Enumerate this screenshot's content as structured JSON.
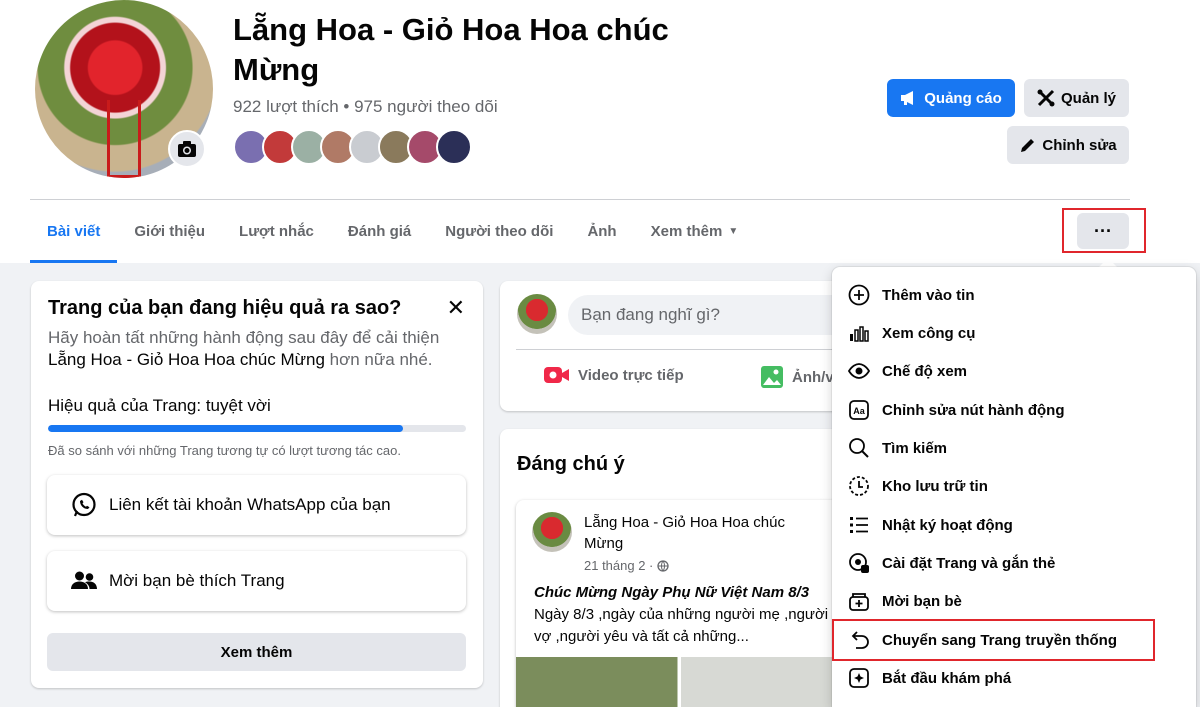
{
  "page": {
    "title": "Lẵng Hoa - Giỏ Hoa Hoa chúc Mừng",
    "stats": "922 lượt thích • 975 người theo dõi"
  },
  "header_buttons": {
    "ads": "Quảng cáo",
    "manage": "Quản lý",
    "edit": "Chỉnh sửa"
  },
  "tabs": [
    {
      "label": "Bài viết",
      "active": true
    },
    {
      "label": "Giới thiệu",
      "active": false
    },
    {
      "label": "Lượt nhắc",
      "active": false
    },
    {
      "label": "Đánh giá",
      "active": false
    },
    {
      "label": "Người theo dõi",
      "active": false
    },
    {
      "label": "Ảnh",
      "active": false
    },
    {
      "label": "Xem thêm",
      "active": false
    }
  ],
  "more_button": "···",
  "performance_card": {
    "title": "Trang của bạn đang hiệu quả ra sao?",
    "close": "✕",
    "description": "Hãy hoàn tất những hành động sau đây để cải thiện",
    "page_name": "Lẵng Hoa - Giỏ Hoa Hoa chúc Mừng",
    "description_end": " hơn nữa nhé.",
    "performance_label": "Hiệu quả của Trang: tuyệt vời",
    "performance_progress": 0.85,
    "compare_note": "Đã so sánh với những Trang tương tự có lượt tương tác cao.",
    "action_whatsapp": "Liên kết tài khoản WhatsApp của bạn",
    "action_invite": "Mời bạn bè thích Trang",
    "see_more": "Xem thêm"
  },
  "composer": {
    "placeholder": "Bạn đang nghĩ gì?",
    "live_video": "Video trực tiếp",
    "photo": "Ảnh/v"
  },
  "highlights": {
    "title": "Đáng chú ý",
    "post": {
      "author": "Lẵng Hoa - Giỏ Hoa Hoa chúc Mừng",
      "date": "21 tháng 2 ·",
      "headline": "Chúc Mừng Ngày Phụ Nữ Việt Nam 8/3",
      "body": "Ngày 8/3 ,ngày của những người mẹ ,người vợ ,người yêu và tất cả những..."
    }
  },
  "menu": {
    "items": [
      {
        "label": "Thêm vào tin",
        "icon": "plus-circle-icon"
      },
      {
        "label": "Xem công cụ",
        "icon": "bar-chart-icon"
      },
      {
        "label": "Chế độ xem",
        "icon": "eye-icon"
      },
      {
        "label": "Chỉnh sửa nút hành động",
        "icon": "text-box-icon"
      },
      {
        "label": "Tìm kiếm",
        "icon": "search-icon"
      },
      {
        "label": "Kho lưu trữ tin",
        "icon": "clock-archive-icon"
      },
      {
        "label": "Nhật ký hoạt động",
        "icon": "list-icon"
      },
      {
        "label": "Cài đặt Trang và gắn thẻ",
        "icon": "settings-tag-icon"
      },
      {
        "label": "Mời bạn bè",
        "icon": "invite-icon"
      },
      {
        "label": "Chuyển sang Trang truyền thống",
        "icon": "undo-arrow-icon"
      },
      {
        "label": "Bắt đầu khám phá",
        "icon": "explore-icon"
      }
    ]
  },
  "colors": {
    "accent": "#1877f2",
    "highlight_box": "#e0262c"
  }
}
